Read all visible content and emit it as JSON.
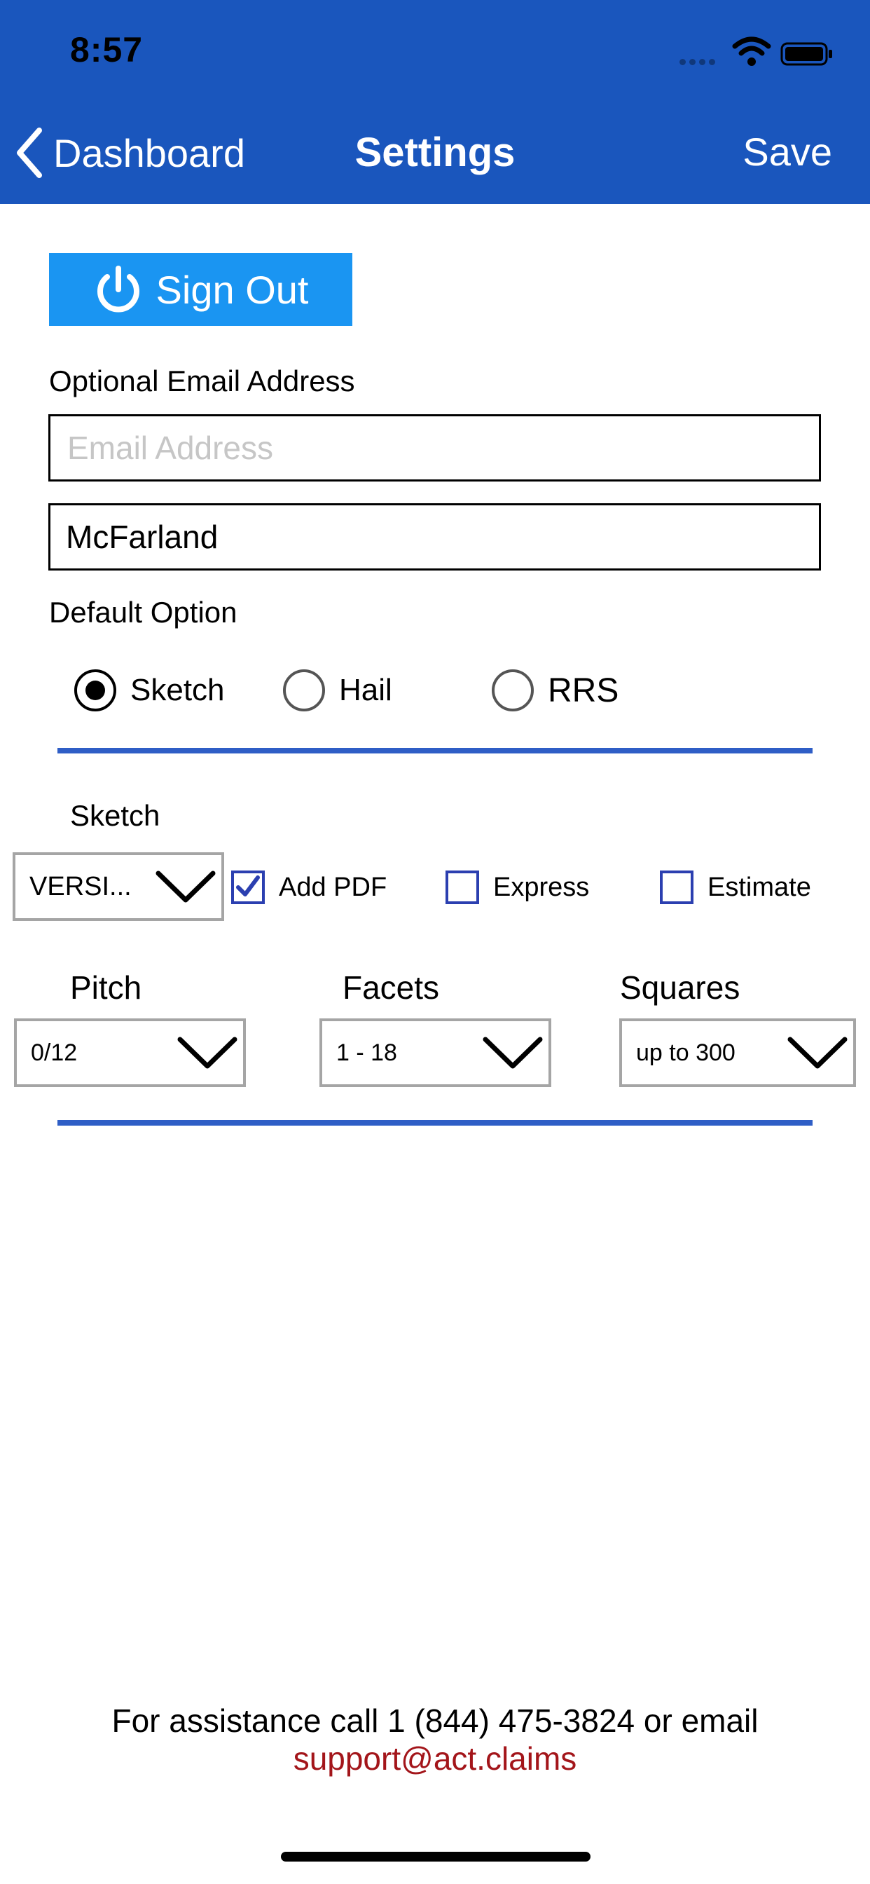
{
  "status_bar": {
    "time": "8:57",
    "icons": [
      "signal-dots-icon",
      "wifi-icon",
      "battery-icon"
    ]
  },
  "nav": {
    "back_label": "Dashboard",
    "title": "Settings",
    "save_label": "Save",
    "background_color": "#1a56bd"
  },
  "sign_out": {
    "label": "Sign Out",
    "icon": "power-icon",
    "color": "#1a95f2"
  },
  "email_section": {
    "label": "Optional Email Address",
    "email_placeholder": "Email Address",
    "email_value": "",
    "name_value": "McFarland"
  },
  "default_option": {
    "label": "Default Option",
    "options": [
      {
        "label": "Sketch",
        "selected": true
      },
      {
        "label": "Hail",
        "selected": false
      },
      {
        "label": "RRS",
        "selected": false
      }
    ]
  },
  "sketch_section": {
    "label": "Sketch",
    "version_value": "VERSI...",
    "checkboxes": [
      {
        "label": "Add PDF",
        "checked": true
      },
      {
        "label": "Express",
        "checked": false
      },
      {
        "label": "Estimate",
        "checked": false
      }
    ],
    "pitch": {
      "label": "Pitch",
      "value": "0/12"
    },
    "facets": {
      "label": "Facets",
      "value": "1 - 18"
    },
    "squares": {
      "label": "Squares",
      "value": "up to 300"
    }
  },
  "footer": {
    "text": "For assistance call 1 (844) 475-3824 or email",
    "email": "support@act.claims",
    "email_color": "#a3151a"
  },
  "accent_color": "#2f5ec6"
}
